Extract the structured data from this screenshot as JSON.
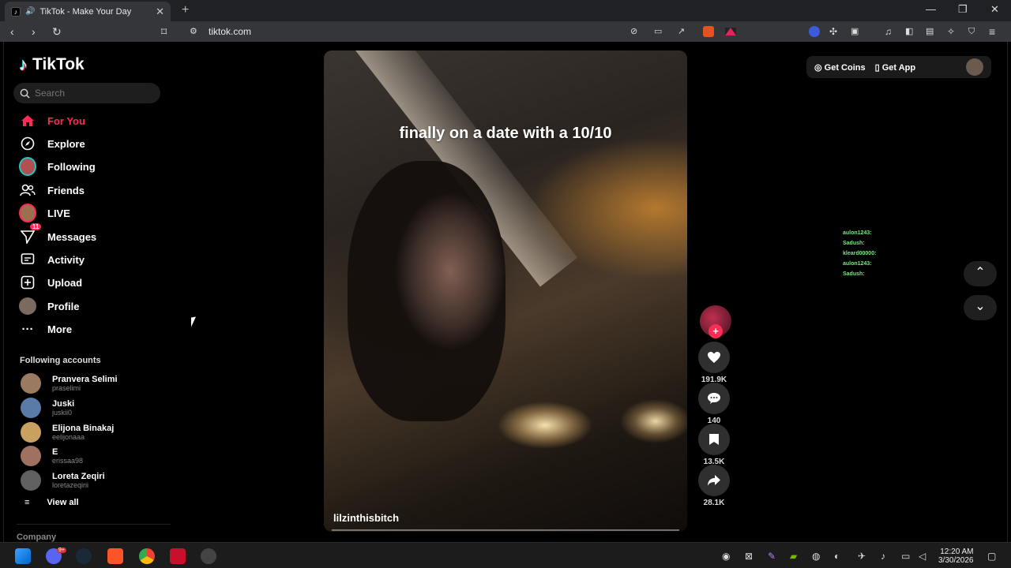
{
  "browser": {
    "tab_title": "TikTok - Make Your Day",
    "url": "tiktok.com"
  },
  "sidebar": {
    "logo": "TikTok",
    "search_placeholder": "Search",
    "nav": [
      {
        "label": "For You",
        "icon": "home-icon"
      },
      {
        "label": "Explore",
        "icon": "compass-icon"
      },
      {
        "label": "Following",
        "icon": "following-avatar-icon"
      },
      {
        "label": "Friends",
        "icon": "friends-icon"
      },
      {
        "label": "LIVE",
        "icon": "live-icon"
      },
      {
        "label": "Messages",
        "icon": "send-icon",
        "badge": "11"
      },
      {
        "label": "Activity",
        "icon": "activity-icon"
      },
      {
        "label": "Upload",
        "icon": "upload-icon"
      },
      {
        "label": "Profile",
        "icon": "profile-avatar-icon"
      },
      {
        "label": "More",
        "icon": "more-icon"
      }
    ],
    "following_heading": "Following accounts",
    "accounts": [
      {
        "name": "Pranvera Selimi",
        "handle": "praselimi"
      },
      {
        "name": "Juski",
        "handle": "juskii0"
      },
      {
        "name": "Elijona Binakaj",
        "handle": "eelijonaaa"
      },
      {
        "name": "E",
        "handle": "erissaa98"
      },
      {
        "name": "Loreta Zeqiri",
        "handle": "loretazeqirii"
      }
    ],
    "view_all": "View all",
    "company": "Company"
  },
  "video": {
    "caption": "finally on a date with a 10/10",
    "username": "lilzinthisbitch",
    "likes": "191.9K",
    "comments": "140",
    "saves": "13.5K",
    "shares": "28.1K"
  },
  "header": {
    "get_coins": "Get Coins",
    "get_app": "Get App"
  },
  "chat": [
    "aulon1243:",
    "Sadush:",
    "kleard00000:",
    "aulon1243:",
    "Sadush:"
  ],
  "taskbar": {
    "time": "12:20 AM",
    "date": "3/30/2026",
    "discord_badge": "9+"
  },
  "colors": {
    "accent": "#fe2c55",
    "chat": "#7fe08a"
  }
}
